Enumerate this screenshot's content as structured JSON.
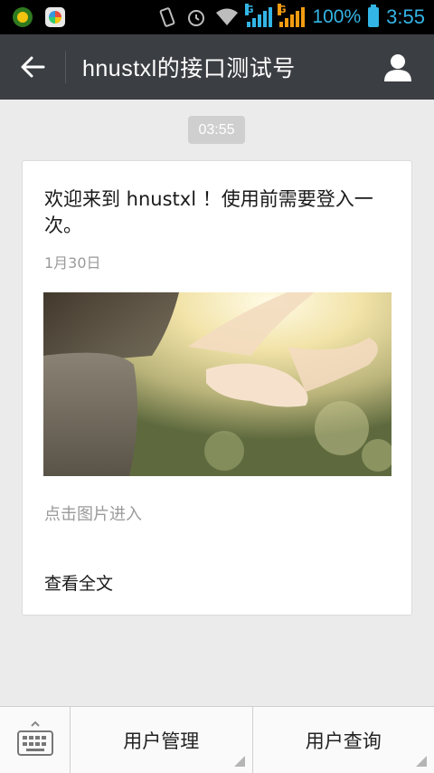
{
  "status_bar": {
    "battery_percent": "100%",
    "time": "3:55",
    "signal_labels": [
      "G",
      "G"
    ]
  },
  "title_bar": {
    "title": "hnustxl的接口测试号"
  },
  "chat": {
    "timestamp": "03:55",
    "card": {
      "title": "欢迎来到 hnustxl ！使用前需要登入一次。",
      "date": "1月30日",
      "description": "点击图片进入",
      "read_more": "查看全文"
    }
  },
  "bottom_menu": {
    "items": [
      {
        "label": "用户管理"
      },
      {
        "label": "用户查询"
      }
    ]
  },
  "colors": {
    "title_bar_bg": "#3b3e43",
    "status_accent": "#33b5e5",
    "page_bg": "#ebebeb"
  }
}
